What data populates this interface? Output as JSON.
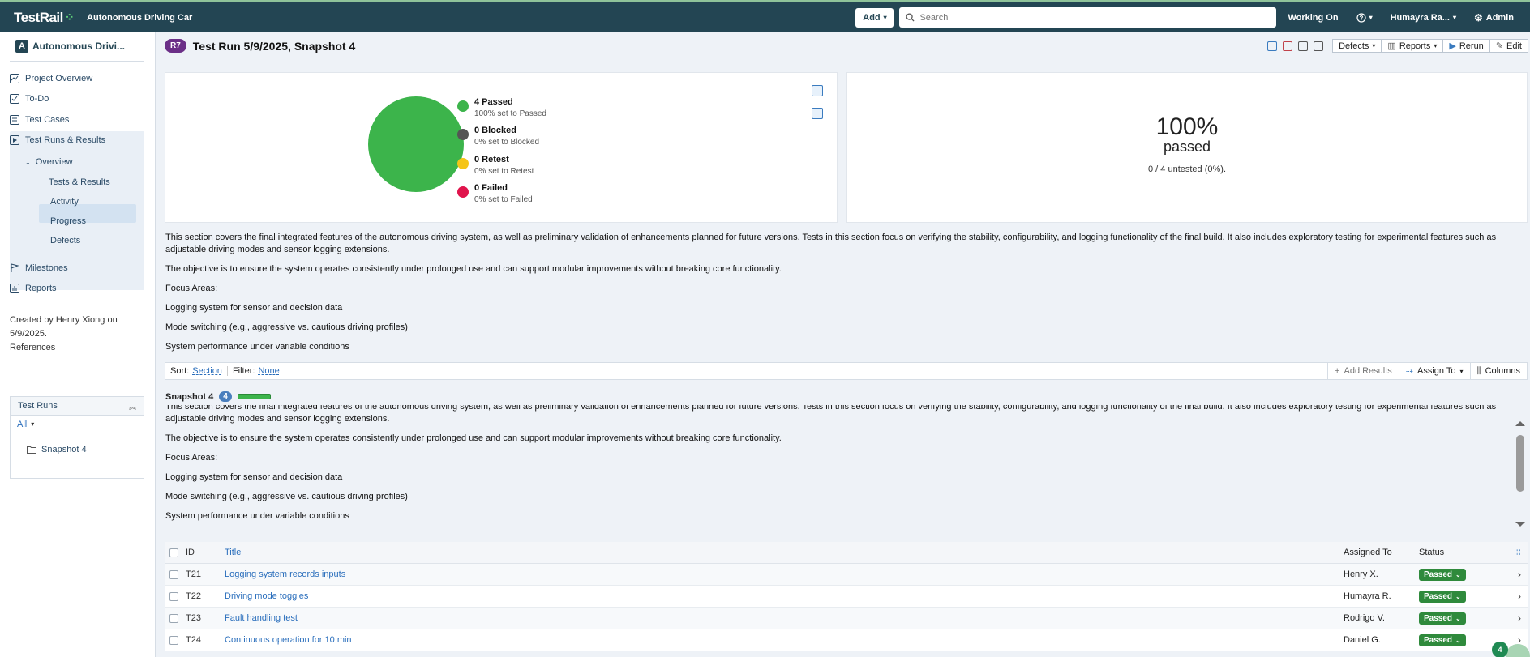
{
  "topbar": {
    "logo_text": "TestRail",
    "project": "Autonomous Driving Car",
    "add_label": "Add",
    "search_placeholder": "Search",
    "working_on": "Working On",
    "user": "Humayra Ra...",
    "admin": "Admin"
  },
  "sidebar": {
    "project_initial": "A",
    "project_name": "Autonomous Drivi...",
    "nav": [
      "Project Overview",
      "To-Do",
      "Test Cases",
      "Test Runs & Results"
    ],
    "overview": "Overview",
    "subnav": [
      "Tests & Results",
      "Activity",
      "Progress",
      "Defects"
    ],
    "nav2": [
      "Milestones",
      "Reports"
    ],
    "created": "Created by Henry Xiong on 5/9/2025.",
    "references": "References",
    "test_runs_title": "Test Runs",
    "filter_all": "All",
    "run_item": "Snapshot 4"
  },
  "run": {
    "badge": "R7",
    "title": "Test Run 5/9/2025, Snapshot 4",
    "toolbar": {
      "defects": "Defects",
      "reports": "Reports",
      "rerun": "Rerun",
      "edit": "Edit"
    }
  },
  "summary": {
    "legend": [
      {
        "title": "4 Passed",
        "sub": "100% set to Passed",
        "color": "#3cb44b"
      },
      {
        "title": "0 Blocked",
        "sub": "0% set to Blocked",
        "color": "#555555"
      },
      {
        "title": "0 Retest",
        "sub": "0% set to Retest",
        "color": "#f5c518"
      },
      {
        "title": "0 Failed",
        "sub": "0% set to Failed",
        "color": "#e0144c"
      }
    ],
    "passed_percent": "100%",
    "passed_word": "passed",
    "untested": "0 / 4 untested (0%)."
  },
  "description": {
    "p1": "This section covers the final integrated features of the autonomous driving system, as well as preliminary validation of enhancements planned for future versions. Tests in this section focus on verifying the stability, configurability, and logging functionality of the final build. It also includes exploratory testing for experimental features such as adjustable driving modes and sensor logging extensions.",
    "p2": "The objective is to ensure the system operates consistently under prolonged use and can support modular improvements without breaking core functionality.",
    "p3": "Focus Areas:",
    "p4": "Logging system for sensor and decision data",
    "p5": "Mode switching (e.g., aggressive vs. cautious driving profiles)",
    "p6": "System performance under variable conditions"
  },
  "sortbar": {
    "sort_label": "Sort:",
    "sort_value": "Section",
    "filter_label": "Filter:",
    "filter_value": "None",
    "add_results": "Add Results",
    "assign_to": "Assign To",
    "columns": "Columns"
  },
  "section": {
    "name": "Snapshot 4",
    "count": "4",
    "desc_p1": "This section covers the final integrated features of the autonomous driving system, as well as preliminary validation of enhancements planned for future versions. Tests in this section focus on verifying the stability, configurability, and logging functionality of the final build. It also includes exploratory testing for experimental features such as adjustable driving modes and sensor logging extensions."
  },
  "table": {
    "headers": {
      "id": "ID",
      "title": "Title",
      "assigned": "Assigned To",
      "status": "Status"
    },
    "rows": [
      {
        "id": "T21",
        "title": "Logging system records inputs",
        "assigned": "Henry X.",
        "status": "Passed"
      },
      {
        "id": "T22",
        "title": "Driving mode toggles",
        "assigned": "Humayra R.",
        "status": "Passed"
      },
      {
        "id": "T23",
        "title": "Fault handling test",
        "assigned": "Rodrigo V.",
        "status": "Passed"
      },
      {
        "id": "T24",
        "title": "Continuous operation for 10 min",
        "assigned": "Daniel G.",
        "status": "Passed"
      }
    ]
  },
  "fab_count": "4"
}
